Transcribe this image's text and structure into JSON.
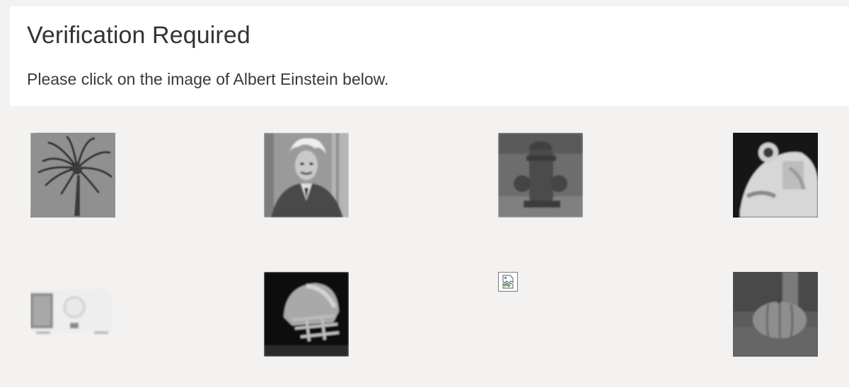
{
  "panel": {
    "title": "Verification Required",
    "instruction": "Please click on the image of Albert Einstein below."
  },
  "tiles": [
    {
      "alt": "palm tree",
      "icon": "palm-tree-image"
    },
    {
      "alt": "Albert Einstein",
      "icon": "einstein-portrait-image"
    },
    {
      "alt": "fire hydrant",
      "icon": "fire-hydrant-image"
    },
    {
      "alt": "astronaut",
      "icon": "astronaut-image"
    },
    {
      "alt": "clock radio",
      "icon": "clock-radio-image"
    },
    {
      "alt": "football helmet",
      "icon": "football-helmet-image"
    },
    {
      "alt": "broken image",
      "icon": "broken-image-icon"
    },
    {
      "alt": "pumpkin",
      "icon": "pumpkin-image"
    }
  ],
  "colors": {
    "page_background": "#f3f2f1",
    "panel_background": "#ffffff",
    "title_text": "#333333"
  }
}
